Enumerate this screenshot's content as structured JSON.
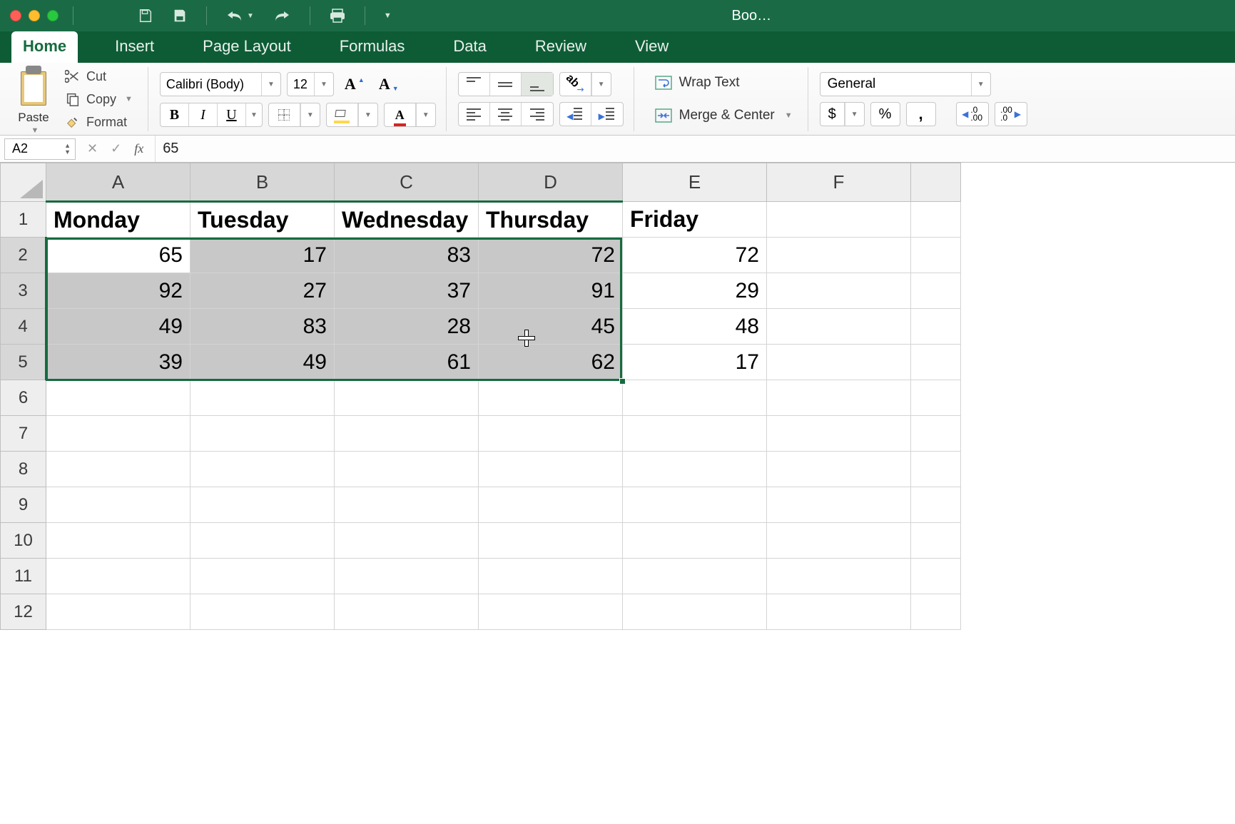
{
  "window": {
    "title": "Boo…"
  },
  "tabs": [
    "Home",
    "Insert",
    "Page Layout",
    "Formulas",
    "Data",
    "Review",
    "View"
  ],
  "active_tab": 0,
  "ribbon": {
    "paste": "Paste",
    "cut": "Cut",
    "copy": "Copy",
    "format": "Format",
    "font_name": "Calibri (Body)",
    "font_size": "12",
    "wrap_text": "Wrap Text",
    "merge_center": "Merge & Center",
    "number_format": "General",
    "currency": "$",
    "percent": "%",
    "comma": "❩",
    "dec_a": ".0",
    "dec_b": ".00"
  },
  "name_box": "A2",
  "formula_value": "65",
  "columns": [
    "A",
    "B",
    "C",
    "D",
    "E",
    "F"
  ],
  "selected_cols": [
    "A",
    "B",
    "C",
    "D"
  ],
  "row_labels": [
    "1",
    "2",
    "3",
    "4",
    "5",
    "6",
    "7",
    "8",
    "9",
    "10",
    "11",
    "12"
  ],
  "selected_rows": [
    "2",
    "3",
    "4",
    "5"
  ],
  "active_cell": "A2",
  "table": {
    "headers": [
      "Monday",
      "Tuesday",
      "Wednesday",
      "Thursday",
      "Friday"
    ],
    "rows": [
      [
        65,
        17,
        83,
        72,
        72
      ],
      [
        92,
        27,
        37,
        91,
        29
      ],
      [
        49,
        83,
        28,
        45,
        48
      ],
      [
        39,
        49,
        61,
        62,
        17
      ]
    ]
  }
}
